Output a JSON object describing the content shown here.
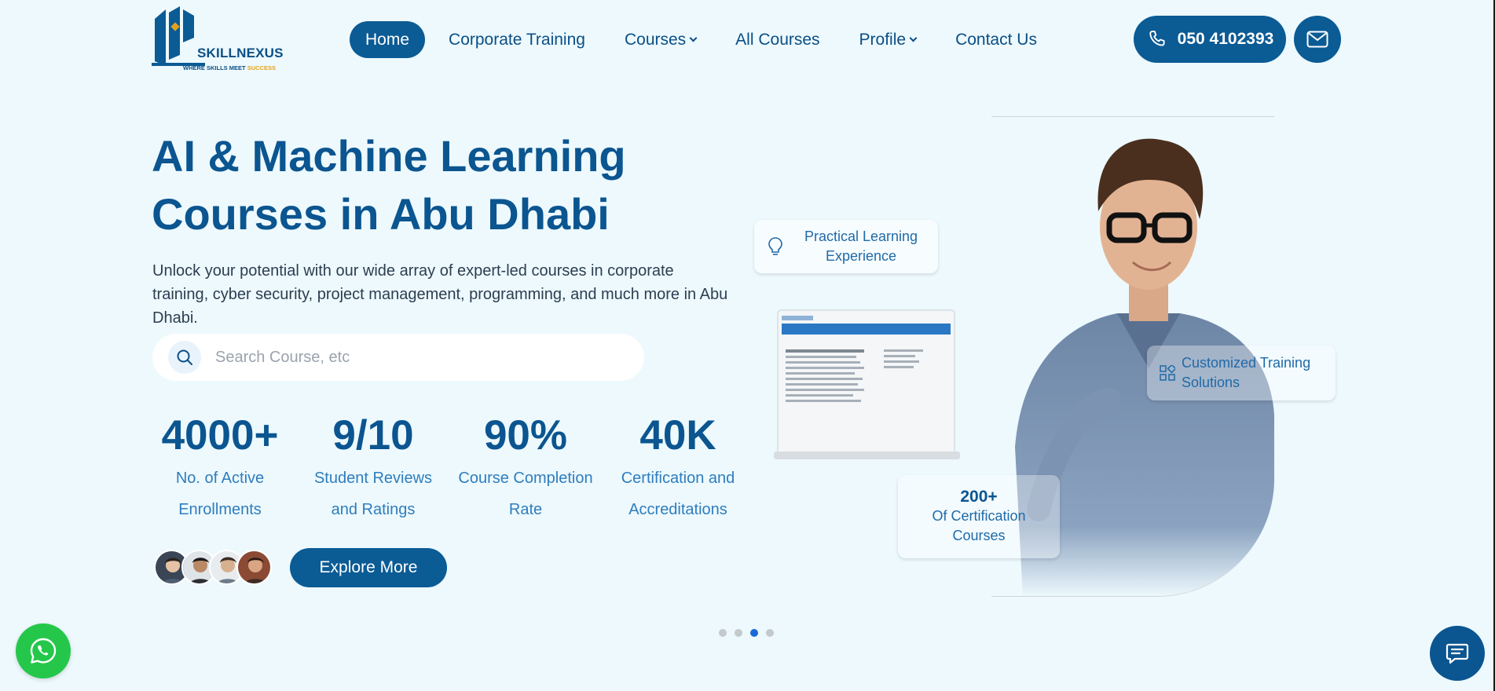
{
  "brand": {
    "name": "SKILLNEXUS",
    "tagline_main": "WHERE SKILLS MEET",
    "tagline_accent": "SUCCESS"
  },
  "nav": {
    "items": [
      {
        "label": "Home",
        "active": true,
        "dropdown": false
      },
      {
        "label": "Corporate Training",
        "active": false,
        "dropdown": false
      },
      {
        "label": "Courses",
        "active": false,
        "dropdown": true
      },
      {
        "label": "All Courses",
        "active": false,
        "dropdown": false
      },
      {
        "label": "Profile",
        "active": false,
        "dropdown": true
      },
      {
        "label": "Contact Us",
        "active": false,
        "dropdown": false
      }
    ]
  },
  "contact": {
    "phone": "050 4102393",
    "phone_icon": "phone-icon",
    "mail_icon": "mail-icon"
  },
  "hero": {
    "title_line1": "AI & Machine Learning",
    "title_line2": "Courses in Abu Dhabi",
    "description": "Unlock your potential with our wide array of expert-led courses in corporate training, cyber security, project management, programming, and much more in Abu Dhabi.",
    "search_placeholder": "Search Course, etc",
    "explore_label": "Explore More"
  },
  "stats": [
    {
      "value": "4000+",
      "label_line1": "No. of Active",
      "label_line2": "Enrollments"
    },
    {
      "value": "9/10",
      "label_line1": "Student Reviews",
      "label_line2": "and Ratings"
    },
    {
      "value": "90%",
      "label_line1": "Course Completion",
      "label_line2": "Rate"
    },
    {
      "value": "40K",
      "label_line1": "Certification and",
      "label_line2": "Accreditations"
    }
  ],
  "floating_cards": {
    "practical_line1": "Practical Learning",
    "practical_line2": "Experience",
    "custom_line1": "Customized Training",
    "custom_line2": "Solutions",
    "cert_value": "200+",
    "cert_line1": "Of Certification",
    "cert_line2": "Courses"
  },
  "carousel": {
    "count": 4,
    "active_index": 2
  },
  "colors": {
    "primary": "#0b5b95",
    "background": "#edf9fd",
    "accent_gold": "#e4a21c",
    "whatsapp": "#25c74b",
    "active_dot": "#1769d8"
  }
}
